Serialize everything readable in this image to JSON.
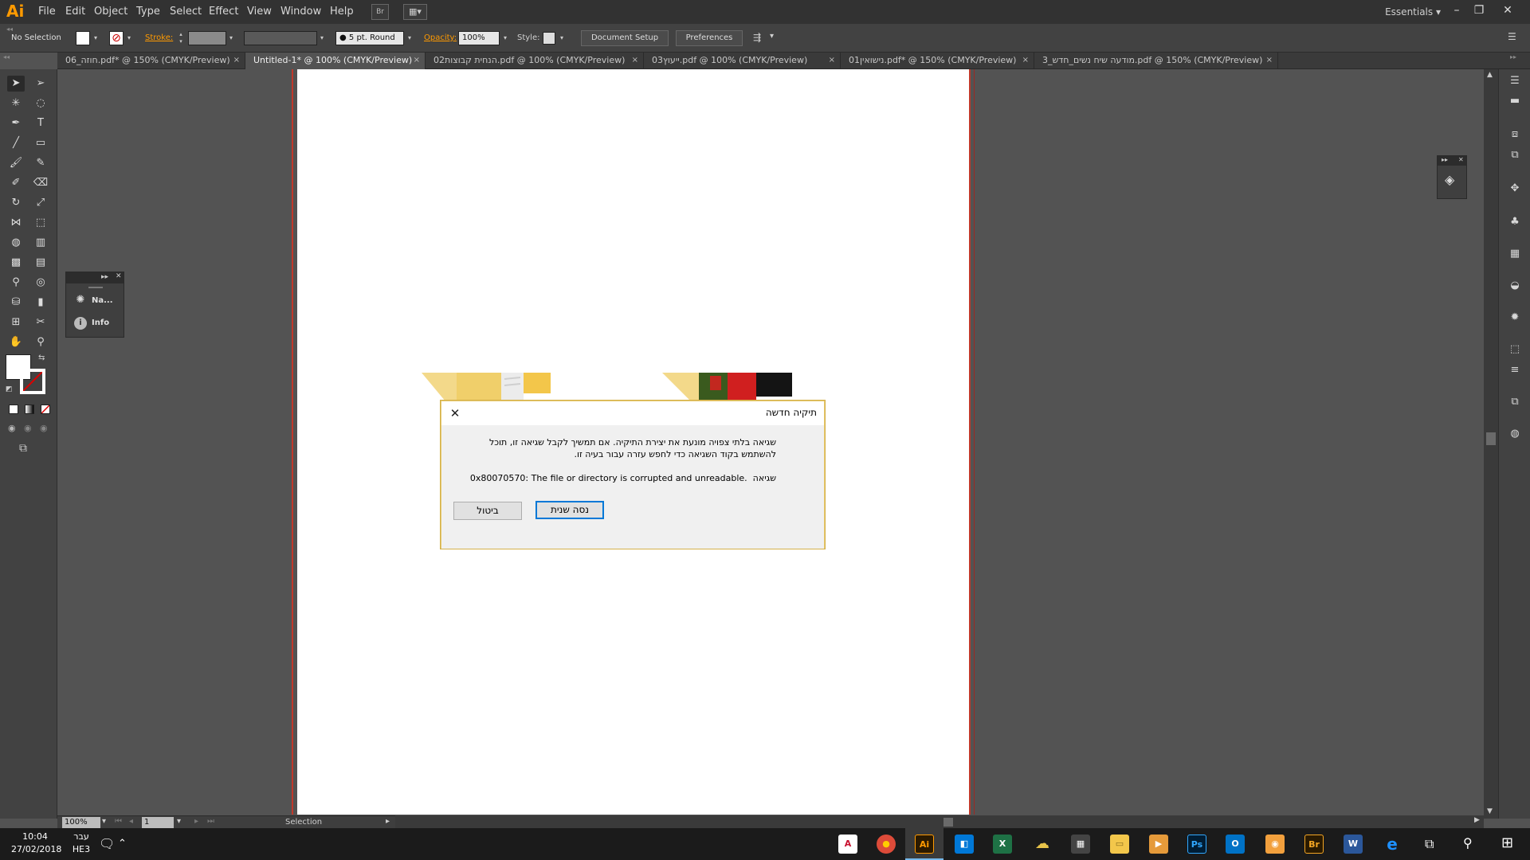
{
  "app": {
    "logo": "Ai",
    "menu": [
      "File",
      "Edit",
      "Object",
      "Type",
      "Select",
      "Effect",
      "View",
      "Window",
      "Help"
    ],
    "bridge_label": "Br",
    "workspace": "Essentials",
    "window_controls": {
      "minimize": "–",
      "restore": "❐",
      "close": "✕"
    }
  },
  "control_bar": {
    "selection": "No Selection",
    "stroke_label": "Stroke:",
    "brush": "5 pt. Round",
    "opacity_label": "Opacity:",
    "opacity_value": "100%",
    "style_label": "Style:",
    "document_setup": "Document Setup",
    "preferences": "Preferences"
  },
  "tabs": [
    {
      "label": "06_חוזה.pdf* @ 150% (CMYK/Preview)",
      "active": false
    },
    {
      "label": "Untitled-1* @ 100% (CMYK/Preview)",
      "active": true
    },
    {
      "label": "02הנחית קבוצות.pdf @ 100% (CMYK/Preview)",
      "active": false
    },
    {
      "label": "03ייעוץ.pdf @ 100% (CMYK/Preview)",
      "active": false
    },
    {
      "label": "01נישואין.pdf* @ 150% (CMYK/Preview)",
      "active": false
    },
    {
      "label": "3_מודעה שיח נשים_חדש.pdf @ 150% (CMYK/Preview)",
      "active": false
    }
  ],
  "tab_close": "×",
  "nav_panel": {
    "items": [
      {
        "label": "Na...",
        "icon": "navigator-icon"
      },
      {
        "label": "Info",
        "icon": "info-icon"
      }
    ]
  },
  "status_bar": {
    "zoom": "100%",
    "page": "1",
    "tool": "Selection"
  },
  "dialog": {
    "title": "תיקיה חדשה",
    "message": "שגיאה בלתי צפויה מונעת את יצירת התיקיה. אם תמשיך לקבל שגיאה זו, תוכל להשתמש בקוד השגיאה כדי לחפש עזרה עבור בעיה זו.",
    "error_label": "שגיאה",
    "error_text": "0x80070570: The file or directory is corrupted and unreadable.",
    "retry_button": "נסה שנית",
    "cancel_button": "ביטול"
  },
  "taskbar": {
    "time": "10:04",
    "date": "27/02/2018",
    "lang_top": "עבר",
    "lang_bottom": "HE3",
    "apps": [
      {
        "name": "acrobat-icon",
        "glyph": "A",
        "color": "#ffffff",
        "text": "#c8102e"
      },
      {
        "name": "chrome-icon",
        "glyph": "●",
        "color": "#dd4b39",
        "text": "#ffcd00"
      },
      {
        "name": "illustrator-icon",
        "glyph": "Ai",
        "color": "#2b1a00",
        "text": "#ff9a00"
      },
      {
        "name": "store-icon",
        "glyph": "◧",
        "color": "#0078d7",
        "text": "#ffffff"
      },
      {
        "name": "excel-icon",
        "glyph": "X",
        "color": "#1e7145",
        "text": "#ffffff"
      },
      {
        "name": "onedrive-icon",
        "glyph": "☁",
        "color": "#e8c44a",
        "text": "#ffffff"
      },
      {
        "name": "calculator-icon",
        "glyph": "▦",
        "color": "#444444",
        "text": "#ffffff"
      },
      {
        "name": "file-explorer-icon",
        "glyph": "▭",
        "color": "#f3c74b",
        "text": "#8a6d1e"
      },
      {
        "name": "media-icon",
        "glyph": "▶",
        "color": "#e59a3a",
        "text": "#ffffff"
      },
      {
        "name": "photoshop-icon",
        "glyph": "Ps",
        "color": "#001d34",
        "text": "#31a8ff"
      },
      {
        "name": "outlook-icon",
        "glyph": "O",
        "color": "#0072c6",
        "text": "#ffffff"
      },
      {
        "name": "paint-icon",
        "glyph": "◉",
        "color": "#f2a03d",
        "text": "#ffffff"
      },
      {
        "name": "bridge-icon",
        "glyph": "Br",
        "color": "#2a1a00",
        "text": "#f5a623"
      },
      {
        "name": "word-icon",
        "glyph": "W",
        "color": "#2b579a",
        "text": "#ffffff"
      },
      {
        "name": "edge-icon",
        "glyph": "e",
        "color": "#1b1b1b",
        "text": "#1e90ff"
      }
    ]
  },
  "colors": {
    "accent_orange": "#ff9a00",
    "dialog_border": "#e6c86c",
    "primary_button_border": "#0078d7",
    "bleed_line": "#c0392b"
  }
}
